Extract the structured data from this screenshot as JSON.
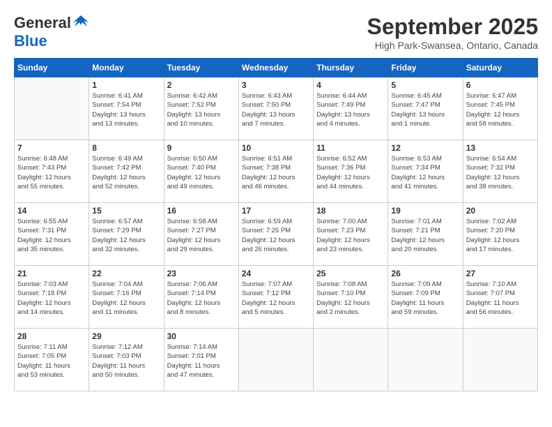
{
  "header": {
    "logo_line1": "General",
    "logo_line2": "Blue",
    "month": "September 2025",
    "location": "High Park-Swansea, Ontario, Canada"
  },
  "weekdays": [
    "Sunday",
    "Monday",
    "Tuesday",
    "Wednesday",
    "Thursday",
    "Friday",
    "Saturday"
  ],
  "weeks": [
    [
      {
        "day": "",
        "info": ""
      },
      {
        "day": "1",
        "info": "Sunrise: 6:41 AM\nSunset: 7:54 PM\nDaylight: 13 hours\nand 13 minutes."
      },
      {
        "day": "2",
        "info": "Sunrise: 6:42 AM\nSunset: 7:52 PM\nDaylight: 13 hours\nand 10 minutes."
      },
      {
        "day": "3",
        "info": "Sunrise: 6:43 AM\nSunset: 7:50 PM\nDaylight: 13 hours\nand 7 minutes."
      },
      {
        "day": "4",
        "info": "Sunrise: 6:44 AM\nSunset: 7:49 PM\nDaylight: 13 hours\nand 4 minutes."
      },
      {
        "day": "5",
        "info": "Sunrise: 6:45 AM\nSunset: 7:47 PM\nDaylight: 13 hours\nand 1 minute."
      },
      {
        "day": "6",
        "info": "Sunrise: 6:47 AM\nSunset: 7:45 PM\nDaylight: 12 hours\nand 58 minutes."
      }
    ],
    [
      {
        "day": "7",
        "info": "Sunrise: 6:48 AM\nSunset: 7:43 PM\nDaylight: 12 hours\nand 55 minutes."
      },
      {
        "day": "8",
        "info": "Sunrise: 6:49 AM\nSunset: 7:42 PM\nDaylight: 12 hours\nand 52 minutes."
      },
      {
        "day": "9",
        "info": "Sunrise: 6:50 AM\nSunset: 7:40 PM\nDaylight: 12 hours\nand 49 minutes."
      },
      {
        "day": "10",
        "info": "Sunrise: 6:51 AM\nSunset: 7:38 PM\nDaylight: 12 hours\nand 46 minutes."
      },
      {
        "day": "11",
        "info": "Sunrise: 6:52 AM\nSunset: 7:36 PM\nDaylight: 12 hours\nand 44 minutes."
      },
      {
        "day": "12",
        "info": "Sunrise: 6:53 AM\nSunset: 7:34 PM\nDaylight: 12 hours\nand 41 minutes."
      },
      {
        "day": "13",
        "info": "Sunrise: 6:54 AM\nSunset: 7:32 PM\nDaylight: 12 hours\nand 38 minutes."
      }
    ],
    [
      {
        "day": "14",
        "info": "Sunrise: 6:55 AM\nSunset: 7:31 PM\nDaylight: 12 hours\nand 35 minutes."
      },
      {
        "day": "15",
        "info": "Sunrise: 6:57 AM\nSunset: 7:29 PM\nDaylight: 12 hours\nand 32 minutes."
      },
      {
        "day": "16",
        "info": "Sunrise: 6:58 AM\nSunset: 7:27 PM\nDaylight: 12 hours\nand 29 minutes."
      },
      {
        "day": "17",
        "info": "Sunrise: 6:59 AM\nSunset: 7:25 PM\nDaylight: 12 hours\nand 26 minutes."
      },
      {
        "day": "18",
        "info": "Sunrise: 7:00 AM\nSunset: 7:23 PM\nDaylight: 12 hours\nand 23 minutes."
      },
      {
        "day": "19",
        "info": "Sunrise: 7:01 AM\nSunset: 7:21 PM\nDaylight: 12 hours\nand 20 minutes."
      },
      {
        "day": "20",
        "info": "Sunrise: 7:02 AM\nSunset: 7:20 PM\nDaylight: 12 hours\nand 17 minutes."
      }
    ],
    [
      {
        "day": "21",
        "info": "Sunrise: 7:03 AM\nSunset: 7:18 PM\nDaylight: 12 hours\nand 14 minutes."
      },
      {
        "day": "22",
        "info": "Sunrise: 7:04 AM\nSunset: 7:16 PM\nDaylight: 12 hours\nand 11 minutes."
      },
      {
        "day": "23",
        "info": "Sunrise: 7:06 AM\nSunset: 7:14 PM\nDaylight: 12 hours\nand 8 minutes."
      },
      {
        "day": "24",
        "info": "Sunrise: 7:07 AM\nSunset: 7:12 PM\nDaylight: 12 hours\nand 5 minutes."
      },
      {
        "day": "25",
        "info": "Sunrise: 7:08 AM\nSunset: 7:10 PM\nDaylight: 12 hours\nand 2 minutes."
      },
      {
        "day": "26",
        "info": "Sunrise: 7:09 AM\nSunset: 7:09 PM\nDaylight: 11 hours\nand 59 minutes."
      },
      {
        "day": "27",
        "info": "Sunrise: 7:10 AM\nSunset: 7:07 PM\nDaylight: 11 hours\nand 56 minutes."
      }
    ],
    [
      {
        "day": "28",
        "info": "Sunrise: 7:11 AM\nSunset: 7:05 PM\nDaylight: 11 hours\nand 53 minutes."
      },
      {
        "day": "29",
        "info": "Sunrise: 7:12 AM\nSunset: 7:03 PM\nDaylight: 11 hours\nand 50 minutes."
      },
      {
        "day": "30",
        "info": "Sunrise: 7:14 AM\nSunset: 7:01 PM\nDaylight: 11 hours\nand 47 minutes."
      },
      {
        "day": "",
        "info": ""
      },
      {
        "day": "",
        "info": ""
      },
      {
        "day": "",
        "info": ""
      },
      {
        "day": "",
        "info": ""
      }
    ]
  ]
}
